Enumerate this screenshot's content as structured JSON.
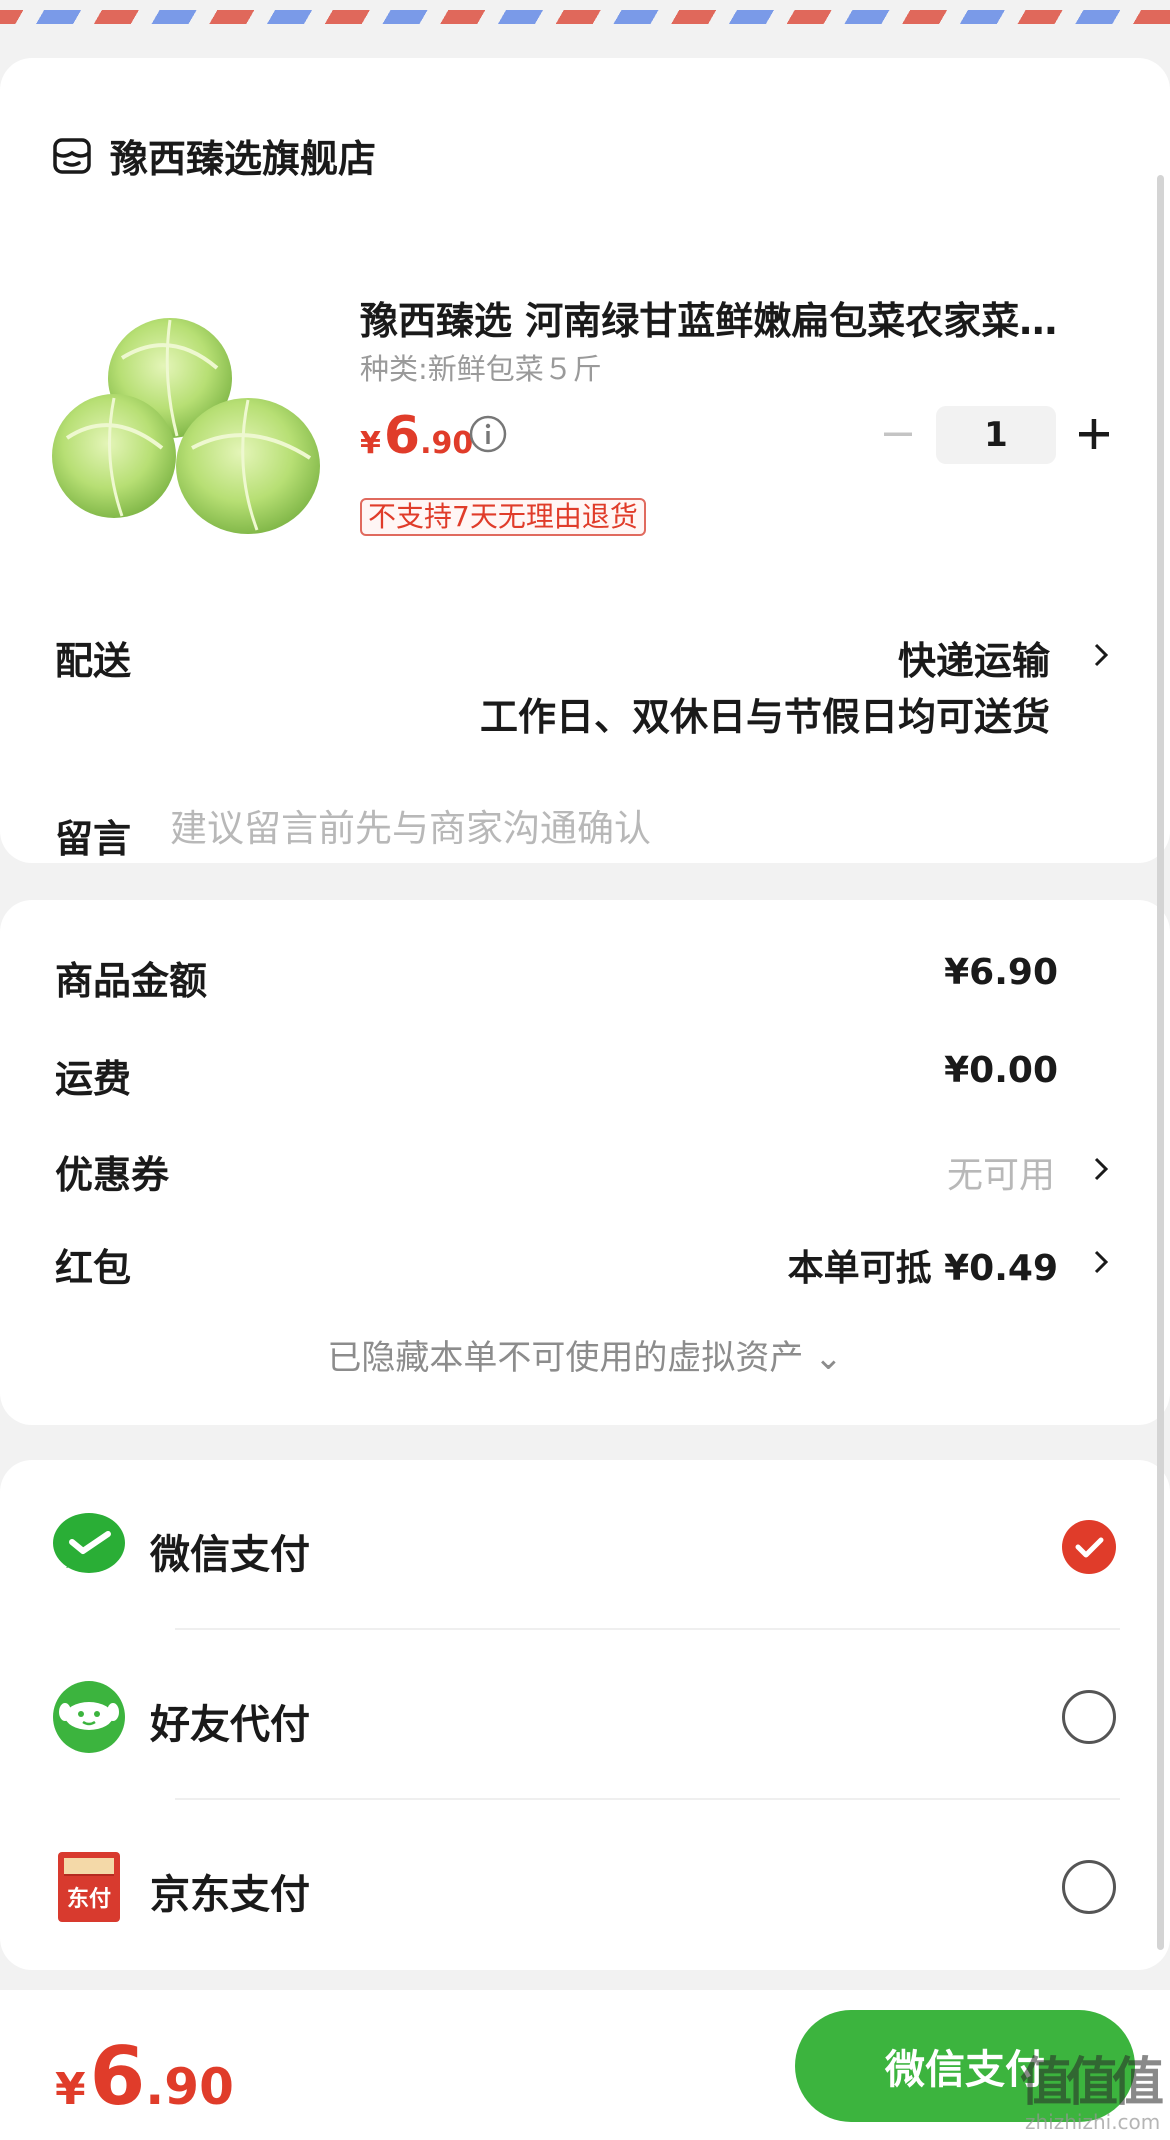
{
  "store": {
    "name": "豫西臻选旗舰店",
    "icon": "store-icon"
  },
  "product": {
    "title": "豫西臻选 河南绿甘蓝鲜嫩扁包菜农家菜…",
    "spec": "种类:新鲜包菜５斤",
    "price": {
      "yen": "¥",
      "int": "6",
      "dec": ".90"
    },
    "quantity": "1",
    "return_policy": "不支持7天无理由退货",
    "image": "cabbage-image"
  },
  "delivery": {
    "label": "配送",
    "method": "快递运输",
    "note": "工作日、双休日与节假日均可送货"
  },
  "remark": {
    "label": "留言",
    "placeholder": "建议留言前先与商家沟通确认"
  },
  "summary": {
    "goods_label": "商品金额",
    "goods_value": "¥6.90",
    "shipping_label": "运费",
    "shipping_value": "¥0.00",
    "coupon_label": "优惠券",
    "coupon_value": "无可用",
    "redpacket_label": "红包",
    "redpacket_value": "本单可抵 ¥0.49",
    "hidden_assets": "已隐藏本单不可使用的虚拟资产 ⌄"
  },
  "payment": {
    "methods": [
      {
        "label": "微信支付",
        "selected": true,
        "icon": "wechat-pay-icon"
      },
      {
        "label": "好友代付",
        "selected": false,
        "icon": "friend-pay-icon"
      },
      {
        "label": "京东支付",
        "selected": false,
        "icon": "jd-pay-icon"
      }
    ]
  },
  "bottom": {
    "total": {
      "yen": "¥",
      "int": "6",
      "dec": ".90"
    },
    "pay_button": "微信支付",
    "watermark": "值值值",
    "watermark_url": "zhizhizhi.com"
  },
  "colors": {
    "price_red": "#e03c2a",
    "pay_green": "#3cb43e",
    "wechat_green": "#2aae36"
  }
}
